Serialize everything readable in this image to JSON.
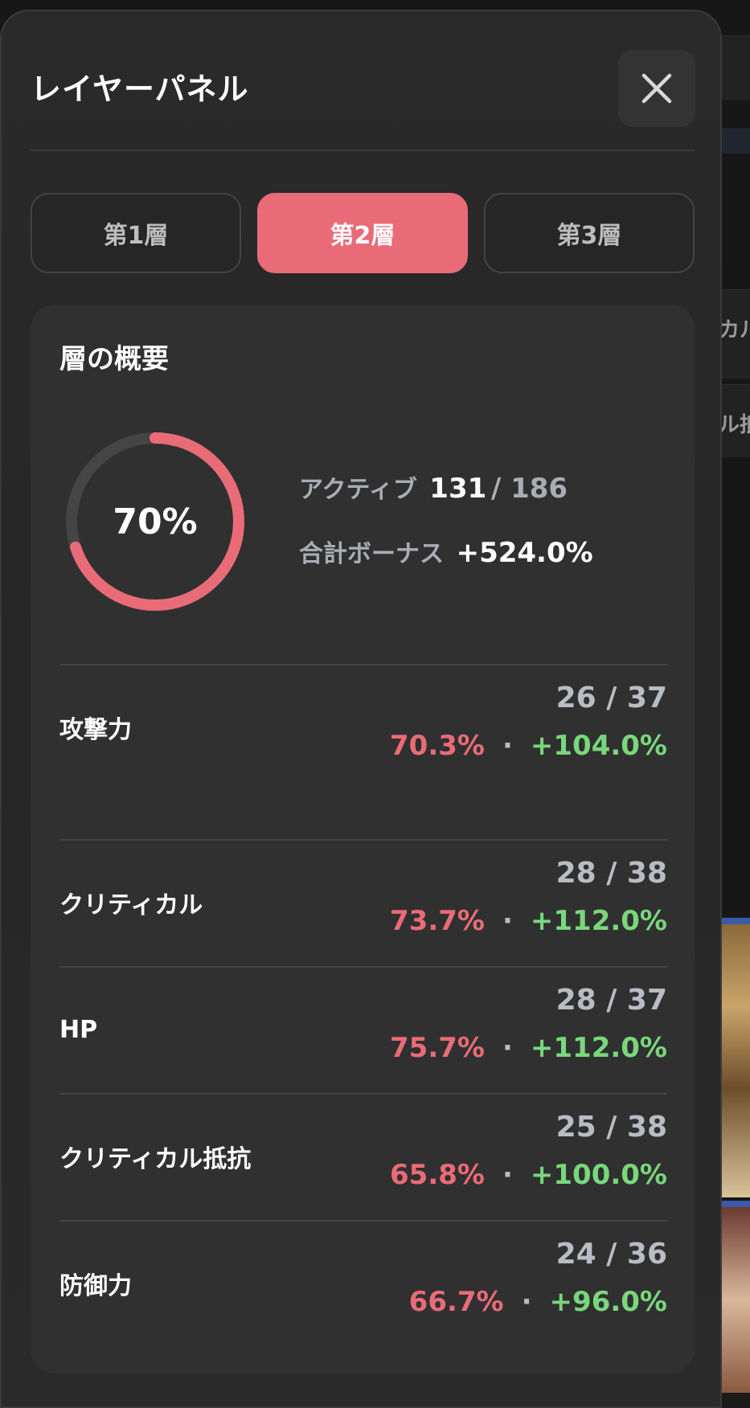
{
  "panel": {
    "title": "レイヤーパネル"
  },
  "tabs": [
    {
      "label": "第1層",
      "active": false
    },
    {
      "label": "第2層",
      "active": true
    },
    {
      "label": "第3層",
      "active": false
    }
  ],
  "summary": {
    "title": "層の概要",
    "progress_percent": 70,
    "progress_label": "70%",
    "active_label": "アクティブ",
    "active_value": "131",
    "active_total": "/ 186",
    "bonus_label": "合計ボーナス",
    "bonus_value": "+524.0%"
  },
  "stats": [
    {
      "name": "攻撃力",
      "count": "26 / 37",
      "percent": "70.3%",
      "bonus": "+104.0%"
    },
    {
      "name": "クリティカル",
      "count": "28 / 38",
      "percent": "73.7%",
      "bonus": "+112.0%"
    },
    {
      "name": "HP",
      "count": "28 / 37",
      "percent": "75.7%",
      "bonus": "+112.0%"
    },
    {
      "name": "クリティカル抵抗",
      "count": "25 / 38",
      "percent": "65.8%",
      "bonus": "+100.0%"
    },
    {
      "name": "防御力",
      "count": "24 / 36",
      "percent": "66.7%",
      "bonus": "+96.0%"
    }
  ],
  "dot_separator": "·",
  "background": {
    "peek_text_1": "カル",
    "peek_text_2": "ル抵"
  },
  "colors": {
    "accent": "#ea6b78",
    "bonus": "#79d77b",
    "muted": "#b8bcc4"
  },
  "icons": {
    "close": "close-icon"
  }
}
